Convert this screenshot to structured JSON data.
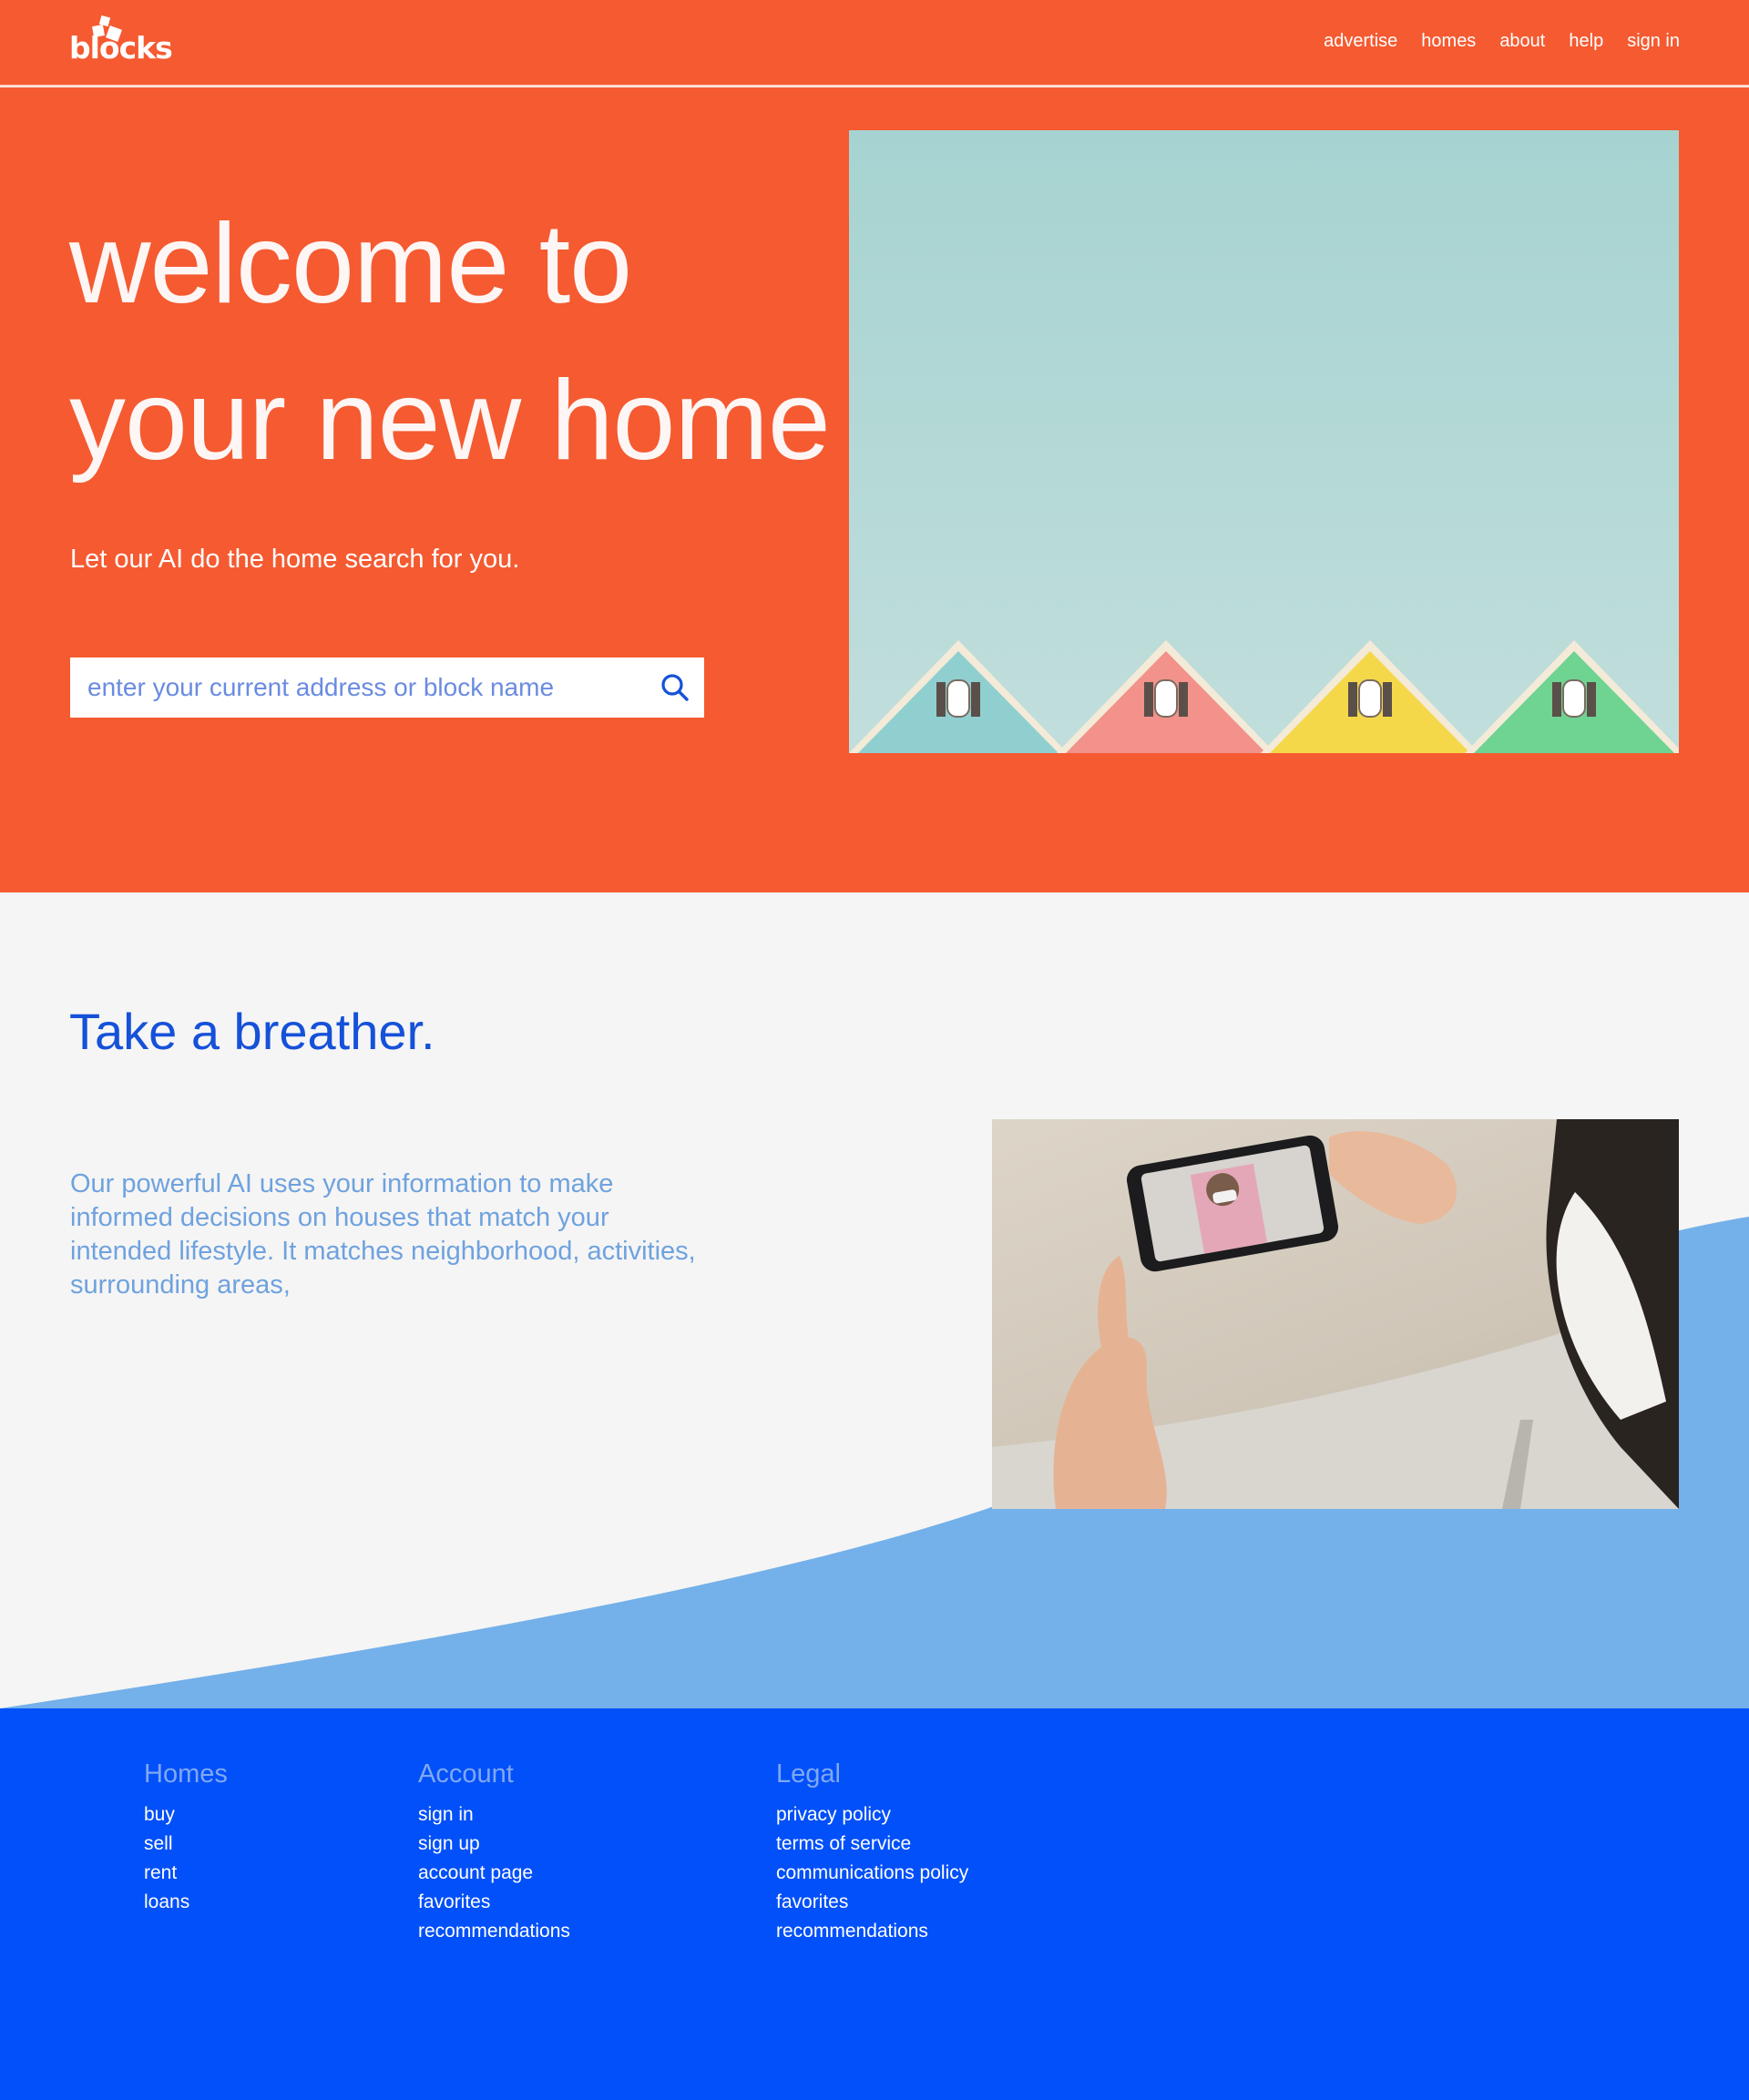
{
  "brand": {
    "logo_text": "blocks",
    "accent": "#f55a31",
    "blue": "#0250f9"
  },
  "nav": {
    "items": [
      "advertise",
      "homes",
      "about",
      "help",
      "sign in"
    ]
  },
  "hero": {
    "title_line1": "welcome to",
    "title_line2": "your new home",
    "subtitle": "Let our AI do the home search for you.",
    "search_placeholder": "enter your current address or block name",
    "search_icon": "search-icon"
  },
  "mid": {
    "title": "Take a breather.",
    "body": "Our powerful AI uses your information to make informed decisions on houses that match your intended lifestyle. It matches neighborhood, activities, surrounding areas,"
  },
  "footer": {
    "columns": [
      {
        "title": "Homes",
        "links": [
          "buy",
          "sell",
          "rent",
          "loans"
        ]
      },
      {
        "title": "Account",
        "links": [
          "sign in",
          "sign up",
          "account page",
          "favorites",
          "recommendations"
        ]
      },
      {
        "title": "Legal",
        "links": [
          "privacy policy",
          "terms of service",
          "communications policy",
          "favorites",
          "recommendations"
        ]
      }
    ]
  }
}
